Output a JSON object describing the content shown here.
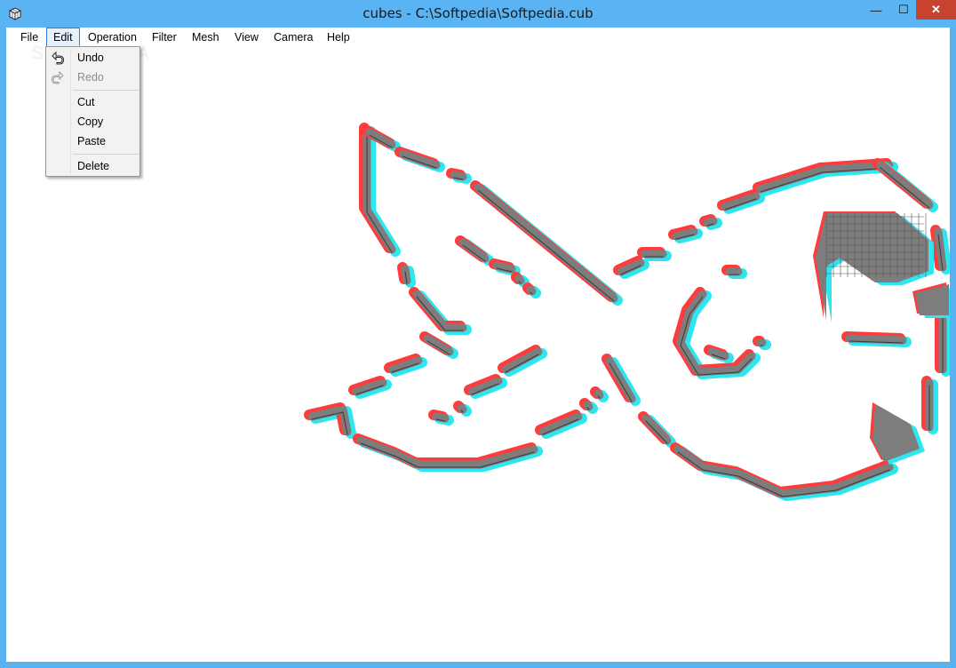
{
  "window": {
    "title": "cubes - C:\\Softpedia\\Softpedia.cub",
    "minimize_glyph": "—",
    "maximize_glyph": "☐",
    "close_glyph": "✕",
    "app_icon": "cube-icon"
  },
  "menubar": {
    "items": [
      {
        "label": "File"
      },
      {
        "label": "Edit"
      },
      {
        "label": "Operation"
      },
      {
        "label": "Filter"
      },
      {
        "label": "Mesh"
      },
      {
        "label": "View"
      },
      {
        "label": "Camera"
      },
      {
        "label": "Help"
      }
    ],
    "active": "Edit"
  },
  "edit_menu": {
    "undo": {
      "label": "Undo",
      "icon": "undo-icon",
      "enabled": true
    },
    "redo": {
      "label": "Redo",
      "icon": "redo-icon",
      "enabled": false
    },
    "cut": {
      "label": "Cut"
    },
    "copy": {
      "label": "Copy"
    },
    "paste": {
      "label": "Paste"
    },
    "delete": {
      "label": "Delete"
    }
  },
  "watermark": "SOFTPEDIA",
  "colors": {
    "titlebar": "#5ab4f4",
    "close": "#c7422f",
    "cube_fill": "#7d7d7d",
    "cube_red": "#ff3b3b",
    "cube_cyan": "#2ee6f0"
  }
}
